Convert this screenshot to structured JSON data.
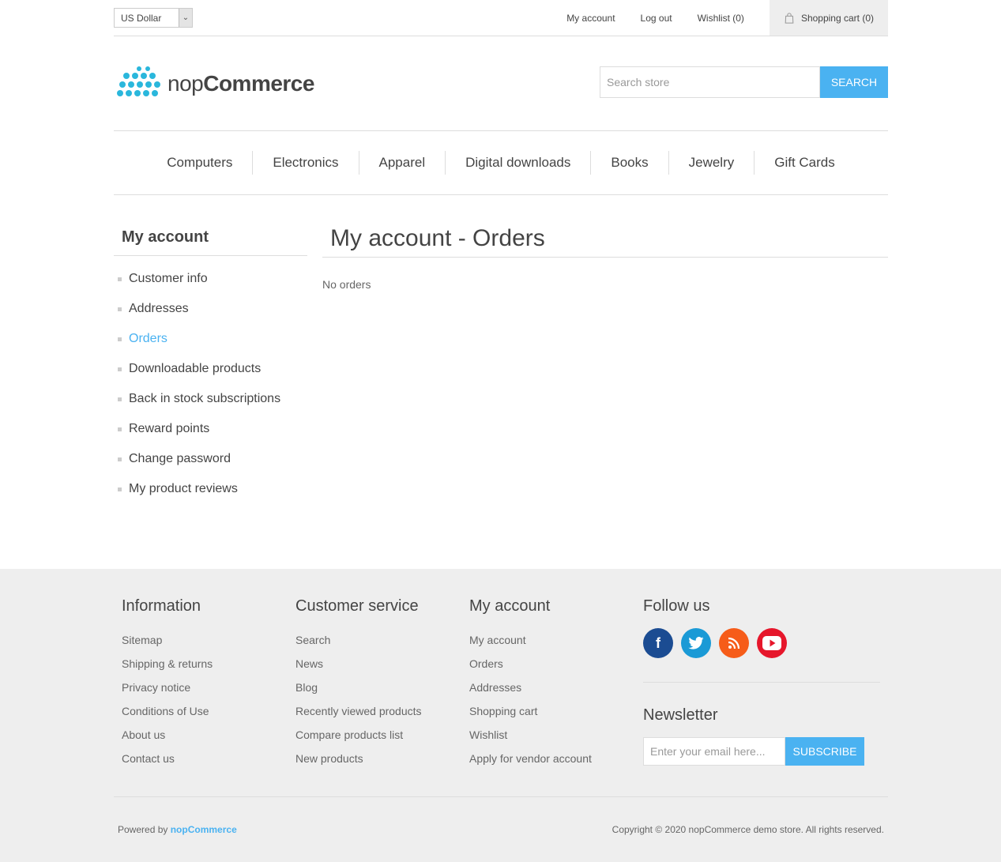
{
  "header": {
    "currency": "US Dollar",
    "links": {
      "my_account": "My account",
      "log_out": "Log out",
      "wishlist": "Wishlist (0)",
      "cart": "Shopping cart (0)"
    },
    "logo": {
      "light": "nop",
      "bold": "Commerce"
    },
    "search": {
      "placeholder": "Search store",
      "button": "Search"
    }
  },
  "menu": [
    "Computers",
    "Electronics",
    "Apparel",
    "Digital downloads",
    "Books",
    "Jewelry",
    "Gift Cards"
  ],
  "sidebar": {
    "title": "My account",
    "items": [
      {
        "label": "Customer info"
      },
      {
        "label": "Addresses"
      },
      {
        "label": "Orders",
        "active": true
      },
      {
        "label": "Downloadable products"
      },
      {
        "label": "Back in stock subscriptions"
      },
      {
        "label": "Reward points"
      },
      {
        "label": "Change password"
      },
      {
        "label": "My product reviews"
      }
    ]
  },
  "main": {
    "title": "My account - Orders",
    "empty_text": "No orders"
  },
  "footer": {
    "information": {
      "title": "Information",
      "items": [
        "Sitemap",
        "Shipping & returns",
        "Privacy notice",
        "Conditions of Use",
        "About us",
        "Contact us"
      ]
    },
    "customer_service": {
      "title": "Customer service",
      "items": [
        "Search",
        "News",
        "Blog",
        "Recently viewed products",
        "Compare products list",
        "New products"
      ]
    },
    "my_account": {
      "title": "My account",
      "items": [
        "My account",
        "Orders",
        "Addresses",
        "Shopping cart",
        "Wishlist",
        "Apply for vendor account"
      ]
    },
    "follow": {
      "title": "Follow us",
      "icons": [
        "facebook-icon",
        "twitter-icon",
        "rss-icon",
        "youtube-icon"
      ]
    },
    "newsletter": {
      "title": "Newsletter",
      "placeholder": "Enter your email here...",
      "button": "Subscribe"
    },
    "powered_by": "Powered by",
    "powered_link": "nopCommerce",
    "copyright": "Copyright © 2020 nopCommerce demo store. All rights reserved."
  },
  "colors": {
    "accent": "#4ab2f1",
    "footer_bg": "#eeeeee",
    "facebook": "#1b4c92",
    "twitter": "#1a9ad6",
    "rss": "#f65c19",
    "youtube": "#e6162b"
  }
}
